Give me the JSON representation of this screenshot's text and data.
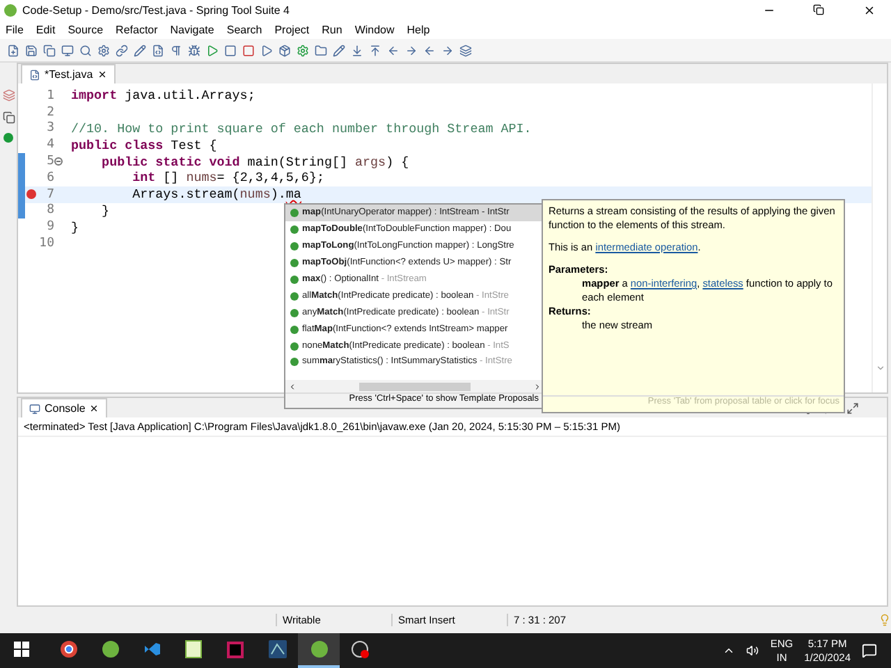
{
  "window": {
    "title": "Code-Setup - Demo/src/Test.java - Spring Tool Suite 4"
  },
  "menu": [
    "File",
    "Edit",
    "Source",
    "Refactor",
    "Navigate",
    "Search",
    "Project",
    "Run",
    "Window",
    "Help"
  ],
  "editor": {
    "tab": {
      "label": "*Test.java",
      "selected": true
    },
    "lines": [
      {
        "number": "1",
        "changed": false,
        "current": false,
        "error": false,
        "foldable": false,
        "segments": [
          {
            "kind": "keyword",
            "text": "import"
          },
          {
            "kind": "text",
            "text": " java.util.Arrays;"
          }
        ]
      },
      {
        "number": "2",
        "changed": false,
        "current": false,
        "error": false,
        "foldable": false
      },
      {
        "number": "3",
        "changed": false,
        "current": false,
        "error": false,
        "foldable": false,
        "segments": [
          {
            "kind": "comment",
            "text": "//10. How to print square of each number through Stream API."
          }
        ]
      },
      {
        "number": "4",
        "changed": false,
        "current": false,
        "error": false,
        "foldable": false,
        "segments": [
          {
            "kind": "keyword",
            "text": "public class"
          },
          {
            "kind": "text",
            "text": " Test {"
          }
        ]
      },
      {
        "number": "5",
        "changed": true,
        "current": false,
        "error": false,
        "foldable": true,
        "segments": [
          {
            "kind": "keyword",
            "text": "    public static void"
          },
          {
            "kind": "text",
            "text": " main(String[] "
          },
          {
            "kind": "variable",
            "text": "args"
          },
          {
            "kind": "text",
            "text": ") {"
          }
        ]
      },
      {
        "number": "6",
        "changed": true,
        "current": false,
        "error": false,
        "foldable": false,
        "segments": [
          {
            "kind": "keyword",
            "text": "        int"
          },
          {
            "kind": "text",
            "text": " [] "
          },
          {
            "kind": "variable",
            "text": "nums"
          },
          {
            "kind": "text",
            "text": "= {2,3,4,5,6};"
          }
        ]
      },
      {
        "number": "7",
        "changed": true,
        "current": true,
        "error": true,
        "foldable": false,
        "segments": [
          {
            "kind": "text",
            "text": "        Arrays.stream("
          },
          {
            "kind": "variable",
            "text": "nums"
          },
          {
            "kind": "text",
            "text": ")."
          },
          {
            "kind": "error",
            "text": "ma"
          }
        ]
      },
      {
        "number": "8",
        "changed": true,
        "current": false,
        "error": false,
        "foldable": false,
        "segments": [
          {
            "kind": "text",
            "text": "    }"
          }
        ]
      },
      {
        "number": "9",
        "changed": false,
        "current": false,
        "error": false,
        "foldable": false,
        "segments": [
          {
            "kind": "text",
            "text": "}"
          }
        ]
      },
      {
        "number": "10",
        "changed": false,
        "current": false,
        "error": false,
        "foldable": false
      }
    ]
  },
  "proposals": {
    "items": [
      {
        "signature": "**map**(IntUnaryOperator mapper) : IntStream - IntStr",
        "selected": true
      },
      {
        "signature": "**mapToDouble**(IntToDoubleFunction mapper) : Dou",
        "selected": false
      },
      {
        "signature": "**mapToLong**(IntToLongFunction mapper) : LongStre",
        "selected": false
      },
      {
        "signature": "**mapToObj**(IntFunction<? extends U> mapper) : Str",
        "selected": false
      },
      {
        "signature": "**max**() : OptionalInt",
        "owner": " - IntStream",
        "selected": false
      },
      {
        "signature": "all**Match**(IntPredicate predicate) : boolean",
        "owner": " - IntStre",
        "selected": false
      },
      {
        "signature": "any**Match**(IntPredicate predicate) : boolean",
        "owner": " - IntStr",
        "selected": false
      },
      {
        "signature": "flat**Map**(IntFunction<? extends IntStream> mapper",
        "selected": false
      },
      {
        "signature": "none**Match**(IntPredicate predicate) : boolean",
        "owner": " - IntS",
        "selected": false
      },
      {
        "signature": "sum**ma**ryStatistics() : IntSummaryStatistics",
        "owner": " - IntStre",
        "selected": false
      }
    ],
    "hint": "Press 'Ctrl+Space' to show Template Proposals"
  },
  "doc": {
    "blocks": [
      {
        "kind": "para",
        "segments": [
          {
            "kind": "text",
            "text": "Returns a stream consisting of the results of applying the given function to the elements of this stream."
          }
        ]
      },
      {
        "kind": "para",
        "segments": [
          {
            "kind": "text",
            "text": "This is an "
          },
          {
            "kind": "link",
            "text": "intermediate operation"
          },
          {
            "kind": "text",
            "text": "."
          }
        ]
      },
      {
        "kind": "heading",
        "segments": [
          {
            "kind": "text",
            "text": "Parameters:"
          }
        ]
      },
      {
        "kind": "indent",
        "segments": [
          {
            "kind": "bold",
            "text": "mapper"
          },
          {
            "kind": "text",
            "text": " a "
          },
          {
            "kind": "link",
            "text": "non-interfering"
          },
          {
            "kind": "text",
            "text": ", "
          },
          {
            "kind": "link",
            "text": "stateless"
          },
          {
            "kind": "text",
            "text": " function to apply to each element"
          }
        ]
      },
      {
        "kind": "heading",
        "segments": [
          {
            "kind": "text",
            "text": "Returns:"
          }
        ]
      },
      {
        "kind": "indent",
        "segments": [
          {
            "kind": "text",
            "text": "the new stream"
          }
        ]
      }
    ],
    "footer": "Press 'Tab' from proposal table or click for focus"
  },
  "console": {
    "tab": {
      "label": "Console",
      "selected": true
    },
    "line": "<terminated> Test [Java Application] C:\\Program Files\\Java\\jdk1.8.0_261\\bin\\javaw.exe  (Jan 20, 2024, 5:15:30 PM – 5:15:31 PM)"
  },
  "status_bar": [
    "Writable",
    "Smart Insert",
    "7 : 31 : 207"
  ],
  "taskbar": {
    "apps": [
      {
        "kind": "browser",
        "selected": false
      },
      {
        "kind": "spring",
        "selected": false
      },
      {
        "kind": "code",
        "selected": false
      },
      {
        "kind": "notepad",
        "selected": false
      },
      {
        "kind": "ide",
        "selected": false
      },
      {
        "kind": "tool",
        "selected": false
      },
      {
        "kind": "spring",
        "selected": true
      },
      {
        "kind": "recorder",
        "selected": false
      }
    ],
    "language": "ENG",
    "region": "IN",
    "time": "5:17 PM",
    "date": "1/20/2024"
  }
}
